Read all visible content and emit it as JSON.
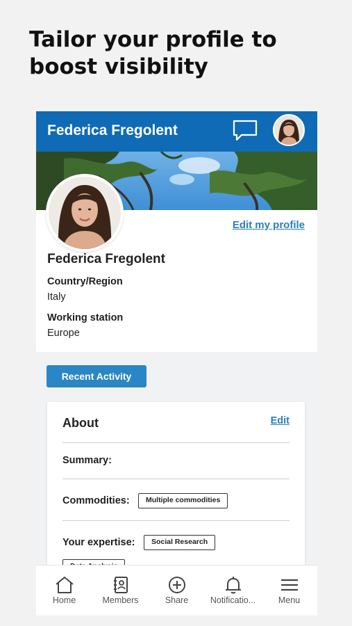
{
  "headline": {
    "line1": "Tailor your profile to",
    "line2": "boost visibility"
  },
  "topbar": {
    "title": "Federica Fregolent",
    "chat_icon": "chat-bubble-icon",
    "bg_color": "#0f6bb5"
  },
  "profile": {
    "edit_link": "Edit my profile",
    "name": "Federica Fregolent",
    "country_label": "Country/Region",
    "country_value": "Italy",
    "station_label": "Working station",
    "station_value": "Europe"
  },
  "activity": {
    "button_label": "Recent Activity",
    "color": "#2a86c4"
  },
  "about": {
    "title": "About",
    "edit_link": "Edit",
    "summary_label": "Summary:",
    "commodities_label": "Commodities:",
    "commodities_chip": "Multiple commodities",
    "expertise_label": "Your expertise:",
    "expertise_chip": "Social Research",
    "expertise_chip_2": "Data Analysis"
  },
  "nav": {
    "items": [
      {
        "label": "Home",
        "icon": "home-icon"
      },
      {
        "label": "Members",
        "icon": "contacts-book-icon"
      },
      {
        "label": "Share",
        "icon": "plus-circle-icon"
      },
      {
        "label": "Notificatio...",
        "icon": "bell-icon"
      },
      {
        "label": "Menu",
        "icon": "hamburger-icon"
      }
    ]
  }
}
